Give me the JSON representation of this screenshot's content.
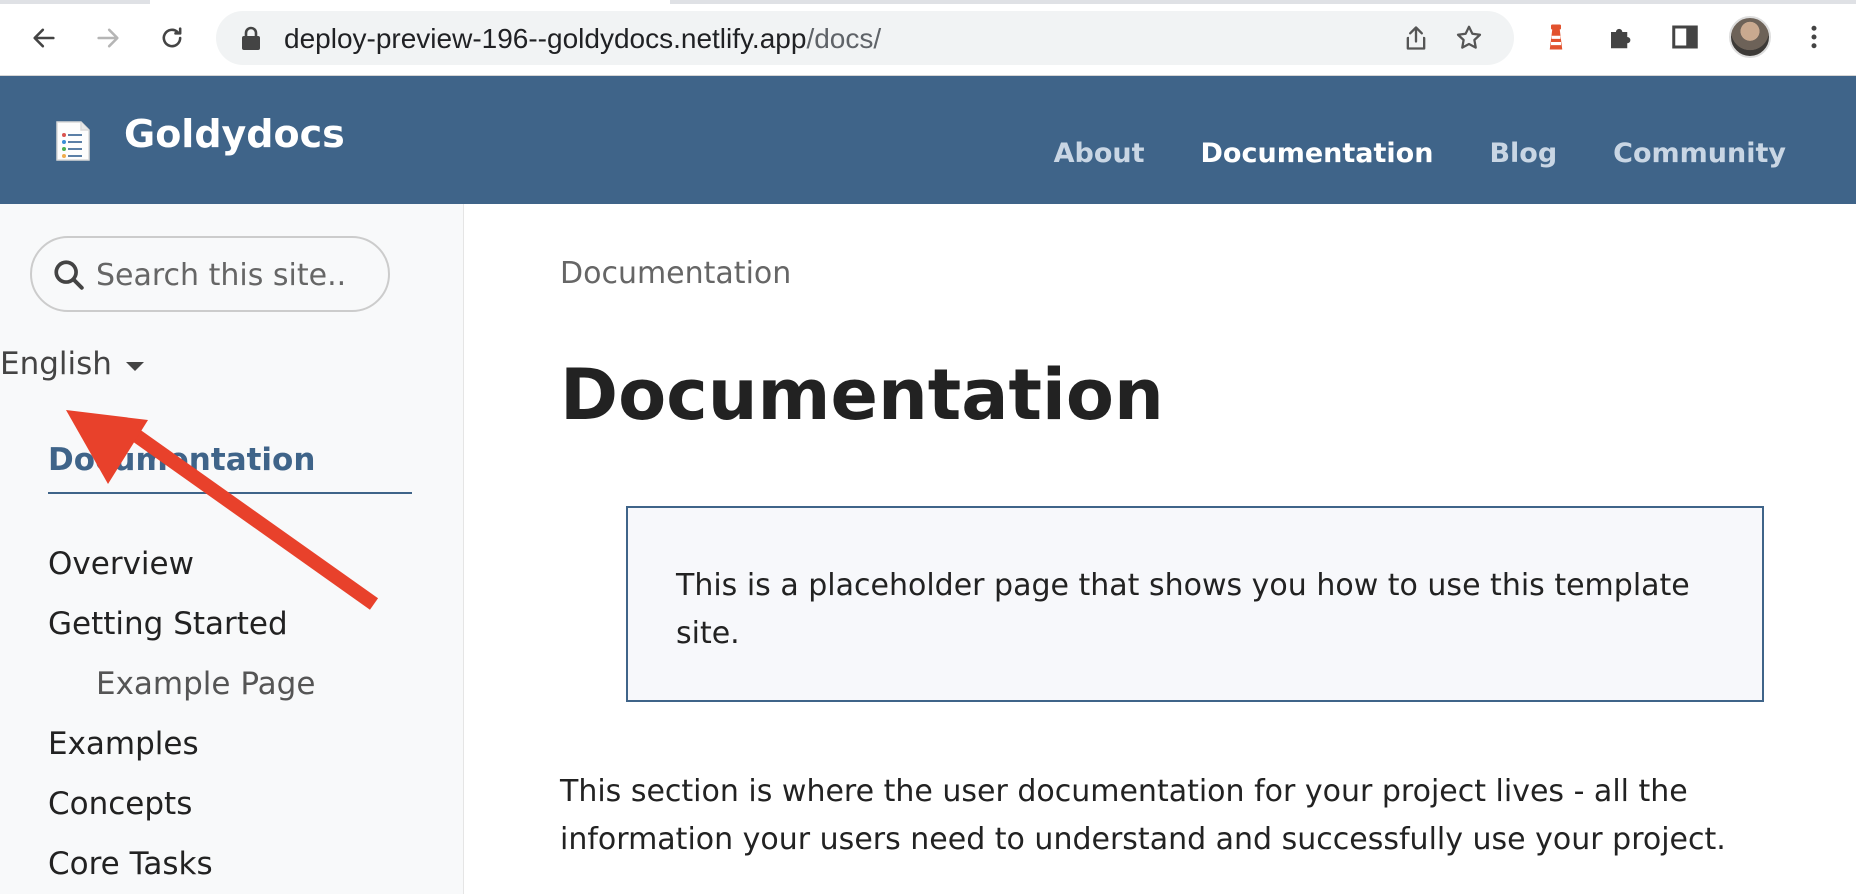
{
  "browser": {
    "url_host": "deploy-preview-196--goldydocs.netlify.app",
    "url_path": "/docs/",
    "icons": {
      "back": "arrow-left-icon",
      "forward": "arrow-right-icon",
      "reload": "reload-icon",
      "lock": "lock-icon",
      "share": "share-icon",
      "bookmark": "star-icon",
      "extension_1": "lighthouse-icon",
      "extensions": "puzzle-icon",
      "side_panel": "side-panel-icon",
      "menu": "kebab-menu-icon"
    }
  },
  "header": {
    "brand": "Goldydocs",
    "nav": [
      {
        "label": "About",
        "active": false
      },
      {
        "label": "Documentation",
        "active": true
      },
      {
        "label": "Blog",
        "active": false
      },
      {
        "label": "Community",
        "active": false
      }
    ],
    "colors": {
      "background": "#3f6489",
      "active_link": "#ffffff",
      "link": "#c9d6e4"
    }
  },
  "sidebar": {
    "search_placeholder": "Search this site..",
    "language": "English",
    "section_title": "Documentation",
    "items": [
      {
        "label": "Overview",
        "level": 1
      },
      {
        "label": "Getting Started",
        "level": 1
      },
      {
        "label": "Example Page",
        "level": 2
      },
      {
        "label": "Examples",
        "level": 1
      },
      {
        "label": "Concepts",
        "level": 1
      },
      {
        "label": "Core Tasks",
        "level": 1
      }
    ]
  },
  "main": {
    "breadcrumb": "Documentation",
    "title": "Documentation",
    "callout": "This is a placeholder page that shows you how to use this template site.",
    "lead": "This section is where the user documentation for your project lives - all the information your users need to understand and successfully use your project."
  },
  "annotation": {
    "arrow_color": "#e8412b"
  }
}
